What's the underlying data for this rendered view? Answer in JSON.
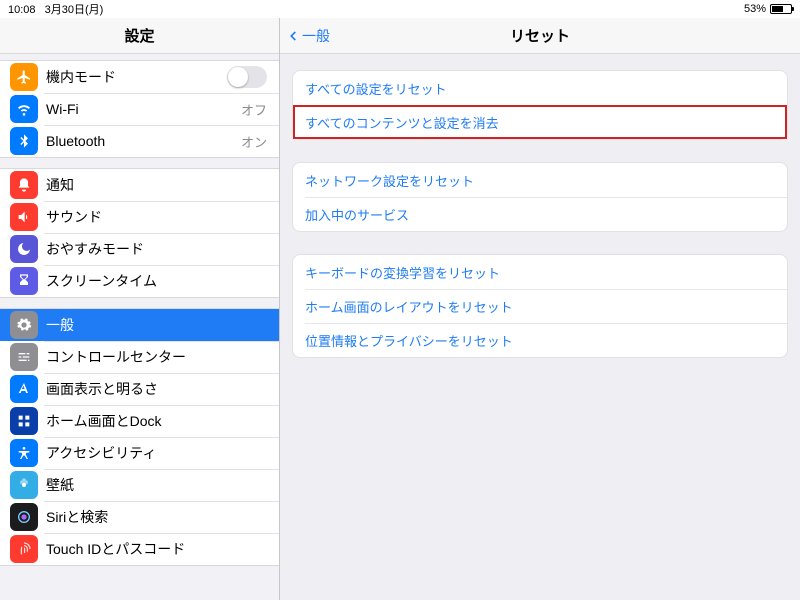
{
  "status": {
    "time": "10:08",
    "date": "3月30日(月)",
    "battery_pct": "53%"
  },
  "sidebar": {
    "title": "設定",
    "g1": {
      "airplane": "機内モード",
      "wifi": "Wi-Fi",
      "wifi_val": "オフ",
      "bt": "Bluetooth",
      "bt_val": "オン"
    },
    "g2": {
      "notif": "通知",
      "sound": "サウンド",
      "dnd": "おやすみモード",
      "screentime": "スクリーンタイム"
    },
    "g3": {
      "general": "一般",
      "control": "コントロールセンター",
      "display": "画面表示と明るさ",
      "home": "ホーム画面とDock",
      "access": "アクセシビリティ",
      "wallpaper": "壁紙",
      "siri": "Siriと検索",
      "touchid": "Touch IDとパスコード"
    }
  },
  "content": {
    "back": "一般",
    "title": "リセット",
    "g1": {
      "reset_all_settings": "すべての設定をリセット",
      "erase_all": "すべてのコンテンツと設定を消去"
    },
    "g2": {
      "reset_network": "ネットワーク設定をリセット",
      "subscriber": "加入中のサービス"
    },
    "g3": {
      "reset_keyboard": "キーボードの変換学習をリセット",
      "reset_home": "ホーム画面のレイアウトをリセット",
      "reset_location": "位置情報とプライバシーをリセット"
    }
  }
}
